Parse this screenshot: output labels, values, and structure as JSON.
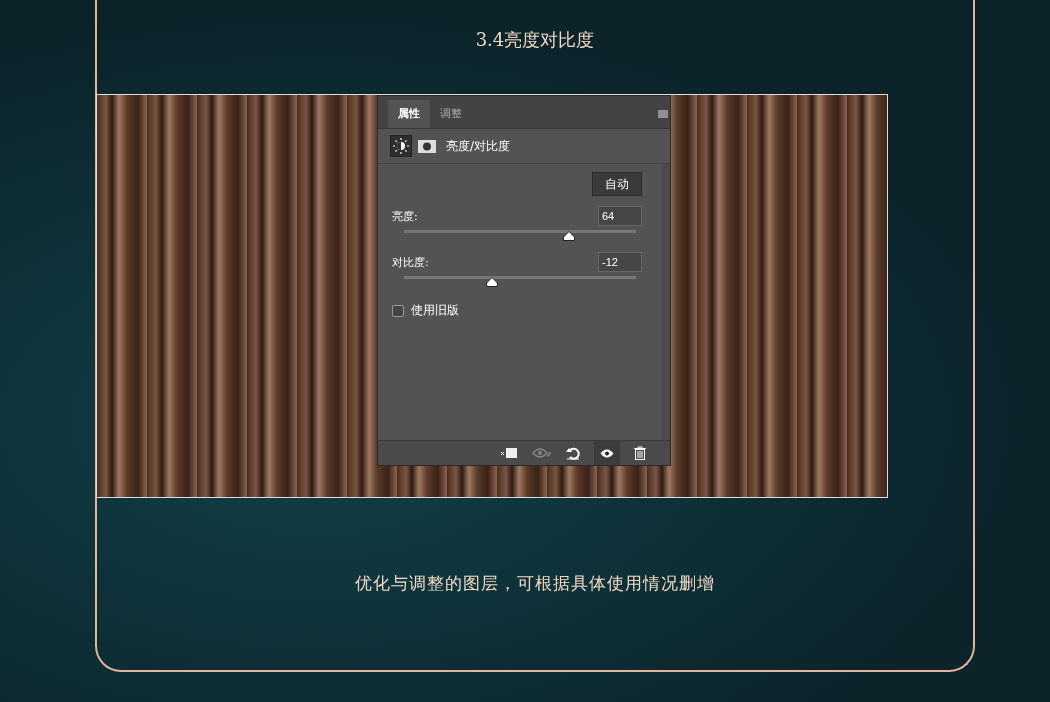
{
  "title": "3.4亮度对比度",
  "panel": {
    "tabs": [
      {
        "label": "属性",
        "selected": true
      },
      {
        "label": "调整",
        "selected": false
      }
    ],
    "heading": "亮度/对比度",
    "auto_button": "自动",
    "sliders": [
      {
        "label": "亮度:",
        "value": "64",
        "level": 0.71
      },
      {
        "label": "对比度:",
        "value": "-12",
        "level": 0.38
      }
    ],
    "legacy": {
      "label": "使用旧版",
      "checked": false
    }
  },
  "caption": "优化与调整的图层，可根据具体使用情况删增"
}
